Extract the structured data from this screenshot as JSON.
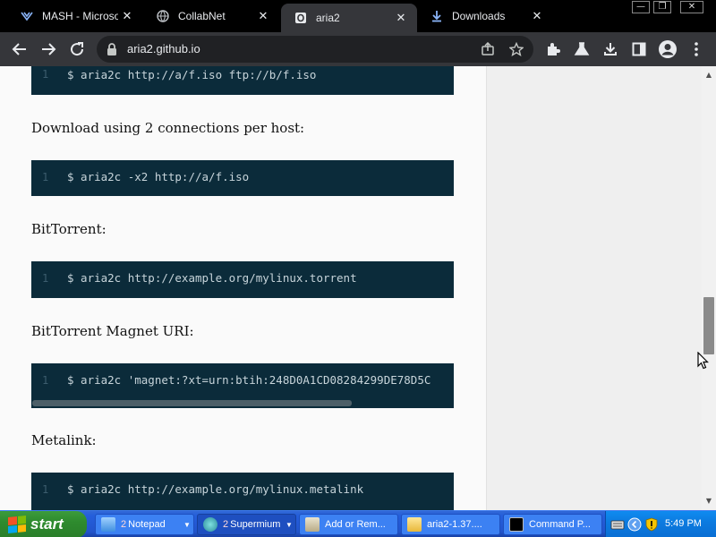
{
  "tabs": [
    {
      "title": "MASH - Microsoft",
      "favicon": "mash-logo-icon",
      "active": false
    },
    {
      "title": "CollabNet",
      "favicon": "globe-icon",
      "active": false
    },
    {
      "title": "aria2",
      "favicon": "aria2-logo-icon",
      "active": true
    },
    {
      "title": "Downloads",
      "favicon": "download-icon",
      "active": false
    }
  ],
  "window_controls": {
    "minimize": "—",
    "restore": "❐",
    "close": "✕"
  },
  "toolbar": {
    "url": "aria2.github.io",
    "icons": [
      "back-arrow-icon",
      "forward-arrow-icon",
      "reload-icon",
      "lock-icon",
      "share-icon",
      "star-icon",
      "extensions-icon",
      "labs-flask-icon",
      "download-icon",
      "side-panel-icon",
      "profile-icon",
      "menu-icon"
    ]
  },
  "page": {
    "blocks": [
      {
        "type": "code",
        "line": "1",
        "text": "$ aria2c http://a/f.iso ftp://b/f.iso"
      },
      {
        "type": "heading",
        "text": "Download using 2 connections per host:"
      },
      {
        "type": "code",
        "line": "1",
        "text": "$ aria2c -x2 http://a/f.iso"
      },
      {
        "type": "heading",
        "text": "BitTorrent:"
      },
      {
        "type": "code",
        "line": "1",
        "text": "$ aria2c http://example.org/mylinux.torrent"
      },
      {
        "type": "heading",
        "text": "BitTorrent Magnet URI:"
      },
      {
        "type": "code",
        "line": "1",
        "text": "$ aria2c 'magnet:?xt=urn:btih:248D0A1CD08284299DE78D5C",
        "scrollable": true
      },
      {
        "type": "heading",
        "text": "Metalink:"
      },
      {
        "type": "code",
        "line": "1",
        "text": "$ aria2c http://example.org/mylinux.metalink"
      }
    ],
    "colors": {
      "code_bg": "#0b2b3a",
      "code_text": "#c7d4da",
      "line_number": "#3c5d6e"
    }
  },
  "taskbar": {
    "start_label": "start",
    "tasks": [
      {
        "label": "Notepad",
        "count": "2",
        "icon": "notepad-icon",
        "active": false,
        "has_arrow": true
      },
      {
        "label": "Supermium",
        "count": "2",
        "icon": "supermium-icon",
        "active": true,
        "has_arrow": true
      },
      {
        "label": "Add or Rem...",
        "icon": "add-remove-programs-icon",
        "active": false
      },
      {
        "label": "aria2-1.37....",
        "icon": "folder-icon",
        "active": false
      },
      {
        "label": "Command P...",
        "icon": "command-prompt-icon",
        "active": false
      }
    ],
    "tray": {
      "clock": "5:49 PM",
      "icons": [
        "keyboard-icon",
        "collapse-tray-icon",
        "security-shield-icon"
      ]
    }
  }
}
